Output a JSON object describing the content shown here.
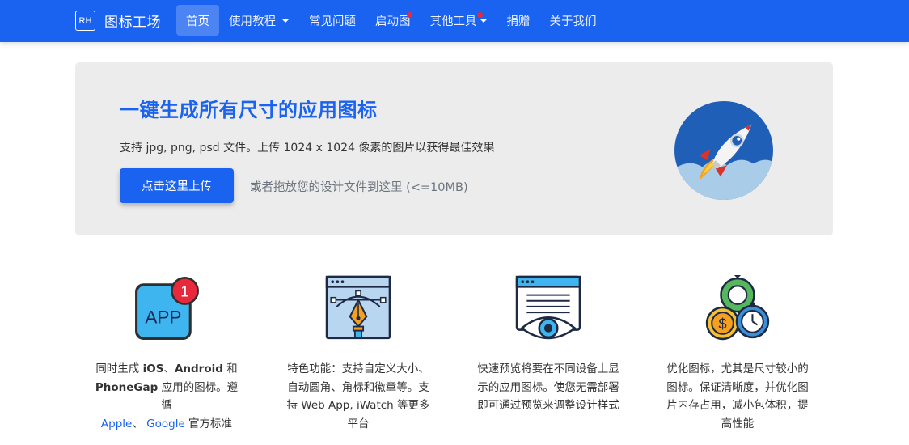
{
  "brand": {
    "logo_text": "RH",
    "name": "图标工场"
  },
  "nav": {
    "home": "首页",
    "tutorial": "使用教程",
    "faq": "常见问题",
    "splash": "启动图",
    "tools": "其他工具",
    "donate": "捐赠",
    "about": "关于我们"
  },
  "hero": {
    "title": "一键生成所有尺寸的应用图标",
    "subtitle": "支持 jpg, png, psd 文件。上传 1024 x 1024 像素的图片以获得最佳效果",
    "upload_button": "点击这里上传",
    "drop_hint": "或者拖放您的设计文件到这里 (<=10MB)"
  },
  "features": {
    "f1": {
      "icon_label": "APP",
      "badge": "1",
      "t1": "同时生成 ",
      "ios": "iOS",
      "t2": "、",
      "android": "Android",
      "t3": " 和",
      "phonegap": "PhoneGap",
      "t4": " 应用的图标。遵循",
      "apple": "Apple",
      "t5": "、 ",
      "google": "Google",
      "t6": " 官方标准"
    },
    "f2": {
      "text": "特色功能：支持自定义大小、自动圆角、角标和徽章等。支持 Web App, iWatch 等更多平台"
    },
    "f3": {
      "text": "快速预览将要在不同设备上显示的应用图标。使您无需部署即可通过预览来调整设计样式"
    },
    "f4": {
      "text": "优化图标，尤其是尺寸较小的图标。保证清晰度，并优化图片内存占用，减小包体积，提高性能"
    }
  },
  "colors": {
    "primary": "#1a62f0",
    "hero_bg": "#ececec",
    "badge_red": "#e8283b"
  },
  "icons": {
    "brand": "rh-logo-icon",
    "hero": "rocket-icon",
    "f1": "app-badge-icon",
    "f2": "pen-tool-icon",
    "f3": "eye-preview-icon",
    "f4": "optimize-coins-icon"
  }
}
